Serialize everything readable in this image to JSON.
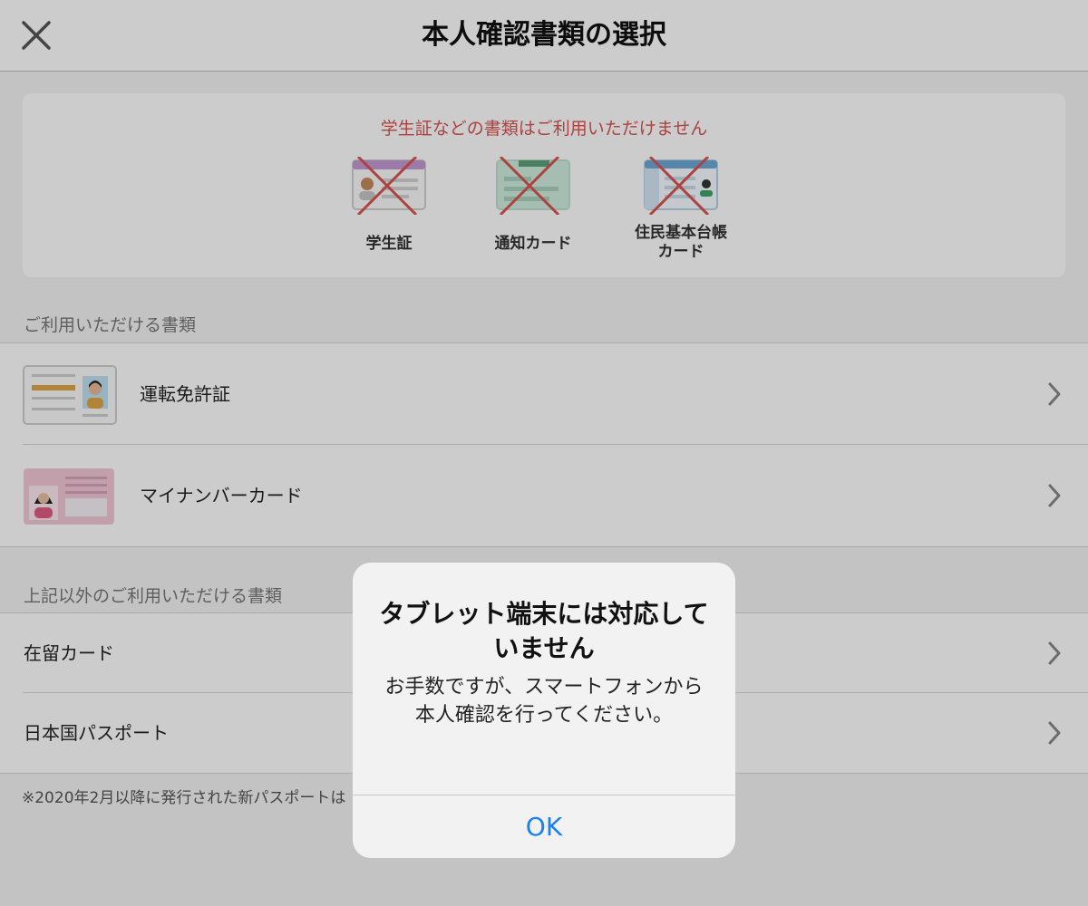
{
  "header": {
    "title": "本人確認書類の選択",
    "close_icon": "close-icon"
  },
  "notice": {
    "text": "学生証などの書類はご利用いただけません",
    "items": [
      {
        "label": "学生証",
        "icon": "student-id-icon"
      },
      {
        "label": "通知カード",
        "icon": "notification-card-icon"
      },
      {
        "label_line1": "住民基本台帳",
        "label_line2": "カード",
        "icon": "resident-registry-card-icon"
      }
    ]
  },
  "section1": {
    "title": "ご利用いただける書類",
    "items": [
      {
        "label": "運転免許証",
        "icon": "drivers-license-icon"
      },
      {
        "label": "マイナンバーカード",
        "icon": "my-number-card-icon"
      }
    ]
  },
  "section2": {
    "title": "上記以外のご利用いただける書類",
    "items": [
      {
        "label": "在留カード"
      },
      {
        "label": "日本国パスポート"
      }
    ]
  },
  "footnote": "※2020年2月以降に発行された新パスポートは",
  "alert": {
    "title": "タブレット端末には対応していません",
    "message": "お手数ですが、スマートフォンから本人確認を行ってください。",
    "ok_label": "OK"
  },
  "colors": {
    "warning": "#d9534f",
    "link": "#1a82f0"
  }
}
